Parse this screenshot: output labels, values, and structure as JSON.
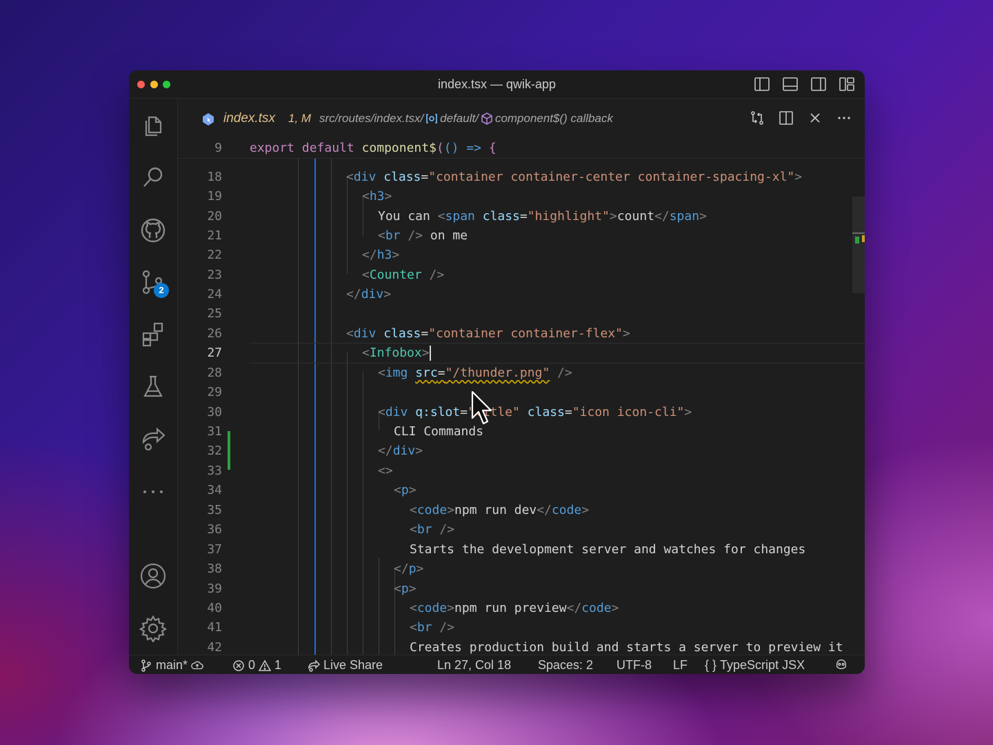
{
  "window": {
    "title": "index.tsx — qwik-app"
  },
  "activity_bar": {
    "items": [
      {
        "name": "explorer-icon"
      },
      {
        "name": "search-icon"
      },
      {
        "name": "github-icon"
      },
      {
        "name": "source-control-icon",
        "badge": "2"
      },
      {
        "name": "extensions-icon"
      },
      {
        "name": "testing-icon"
      },
      {
        "name": "remote-explorer-icon"
      },
      {
        "name": "more-icon"
      },
      {
        "name": "accounts-icon"
      },
      {
        "name": "settings-gear-icon"
      }
    ]
  },
  "tab": {
    "filename": "index.tsx",
    "status": "1, M",
    "breadcrumb": {
      "path": "src/routes/index.tsx/",
      "symbol1": "default/",
      "symbol2": "component$() callback"
    }
  },
  "editor": {
    "sticky_line": {
      "number": "9",
      "text": "export default component$(() => {"
    },
    "current_line": "27",
    "lines": [
      {
        "number": "18"
      },
      {
        "number": "19"
      },
      {
        "number": "20"
      },
      {
        "number": "21"
      },
      {
        "number": "22"
      },
      {
        "number": "23"
      },
      {
        "number": "24"
      },
      {
        "number": "25"
      },
      {
        "number": "26"
      },
      {
        "number": "27"
      },
      {
        "number": "28"
      },
      {
        "number": "29"
      },
      {
        "number": "30"
      },
      {
        "number": "31"
      },
      {
        "number": "32"
      },
      {
        "number": "33"
      },
      {
        "number": "34"
      },
      {
        "number": "35"
      },
      {
        "number": "36"
      },
      {
        "number": "37"
      },
      {
        "number": "38"
      },
      {
        "number": "39"
      },
      {
        "number": "40"
      },
      {
        "number": "41"
      },
      {
        "number": "42"
      }
    ],
    "code": {
      "l18_attr_value": "\"container container-center container-spacing-xl\"",
      "l20_text": "You can ",
      "l20_span_value": "\"highlight\"",
      "l20_inner": "count",
      "l21_text": " on me",
      "l23_comp": "Counter",
      "l26_attr_value": "\"container container-flex\"",
      "l27_comp": "Infobox",
      "l28_src": "\"/thunder.png\"",
      "l30_slot": "\"title\"",
      "l30_class": "\"icon icon-cli\"",
      "l31_text": "CLI Commands",
      "l35_code": "npm run dev",
      "l37_text": "Starts the development server and watches for changes",
      "l40_code": "npm run preview",
      "l42_text": "Creates production build and starts a server to preview it"
    }
  },
  "status_bar": {
    "branch": "main*",
    "errors": "0",
    "warnings": "1",
    "live_share": "Live Share",
    "position": "Ln 27, Col 18",
    "spaces": "Spaces: 2",
    "encoding": "UTF-8",
    "eol": "LF",
    "language": "TypeScript JSX"
  }
}
